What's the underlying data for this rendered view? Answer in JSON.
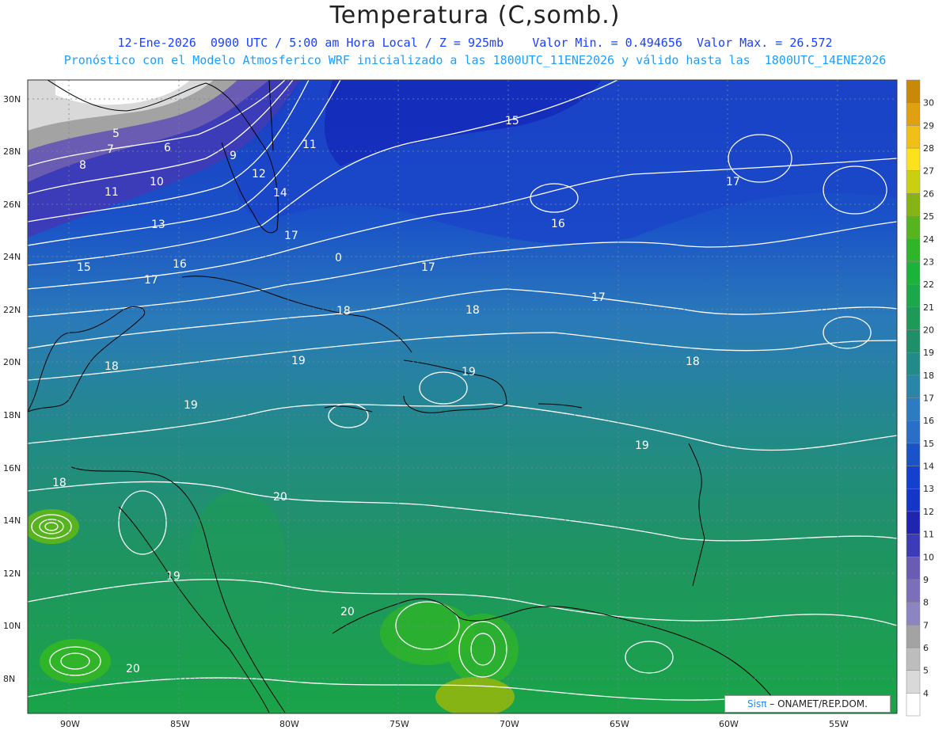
{
  "header": {
    "title": "Temperatura (C,somb.)",
    "line1": "12-Ene-2026  0900 UTC / 5:00 am Hora Local / Z = 925mb    Valor Min. = 0.494656  Valor Max. = 26.572",
    "line2": "Pronóstico con el Modelo Atmosferico WRF inicializado a las 1800UTC_11ENE2026 y válido hasta las  1800UTC_14ENE2026"
  },
  "map": {
    "lon_ticks": [
      "90W",
      "85W",
      "80W",
      "75W",
      "70W",
      "65W",
      "60W",
      "55W"
    ],
    "lat_ticks": [
      "30N",
      "28N",
      "26N",
      "24N",
      "22N",
      "20N",
      "18N",
      "16N",
      "14N",
      "12N",
      "10N",
      "8N"
    ],
    "contour_labels": [
      {
        "text": "5"
      },
      {
        "text": "7"
      },
      {
        "text": "6"
      },
      {
        "text": "8"
      },
      {
        "text": "10"
      },
      {
        "text": "11"
      },
      {
        "text": "9"
      },
      {
        "text": "12"
      },
      {
        "text": "14"
      },
      {
        "text": "11"
      },
      {
        "text": "15"
      },
      {
        "text": "13"
      },
      {
        "text": "15"
      },
      {
        "text": "16"
      },
      {
        "text": "17"
      },
      {
        "text": "17"
      },
      {
        "text": "16"
      },
      {
        "text": "17"
      },
      {
        "text": "17"
      },
      {
        "text": "17"
      },
      {
        "text": "18"
      },
      {
        "text": "18"
      },
      {
        "text": "19"
      },
      {
        "text": "19"
      },
      {
        "text": "18"
      },
      {
        "text": "18"
      },
      {
        "text": "19"
      },
      {
        "text": "19"
      },
      {
        "text": "18"
      },
      {
        "text": "20"
      },
      {
        "text": "19"
      },
      {
        "text": "20"
      },
      {
        "text": "20"
      },
      {
        "text": "0"
      }
    ]
  },
  "colorbar": {
    "labels": [
      "4",
      "5",
      "6",
      "7",
      "8",
      "9",
      "10",
      "11",
      "12",
      "13",
      "14",
      "15",
      "16",
      "17",
      "18",
      "19",
      "20",
      "21",
      "22",
      "23",
      "24",
      "25",
      "26",
      "27",
      "28",
      "29",
      "30"
    ],
    "colors": [
      "#ffffff",
      "#d9d9d9",
      "#bdbdbd",
      "#a3a3a3",
      "#8c86c0",
      "#7a6fb8",
      "#6a5cb2",
      "#3c3cb8",
      "#1f25b0",
      "#1435c8",
      "#1440d0",
      "#1a52c8",
      "#2a6ec8",
      "#2b7cc0",
      "#2a86a8",
      "#238a8a",
      "#1f8e6a",
      "#1e9a58",
      "#1aa84a",
      "#1ab43a",
      "#30b428",
      "#58b41e",
      "#86b414",
      "#c8d010",
      "#fae21c",
      "#f0c018",
      "#e0a010",
      "#c88808"
    ]
  },
  "credit": {
    "sis": "Sisπ",
    "rest": " – ONAMET/REP.DOM."
  }
}
